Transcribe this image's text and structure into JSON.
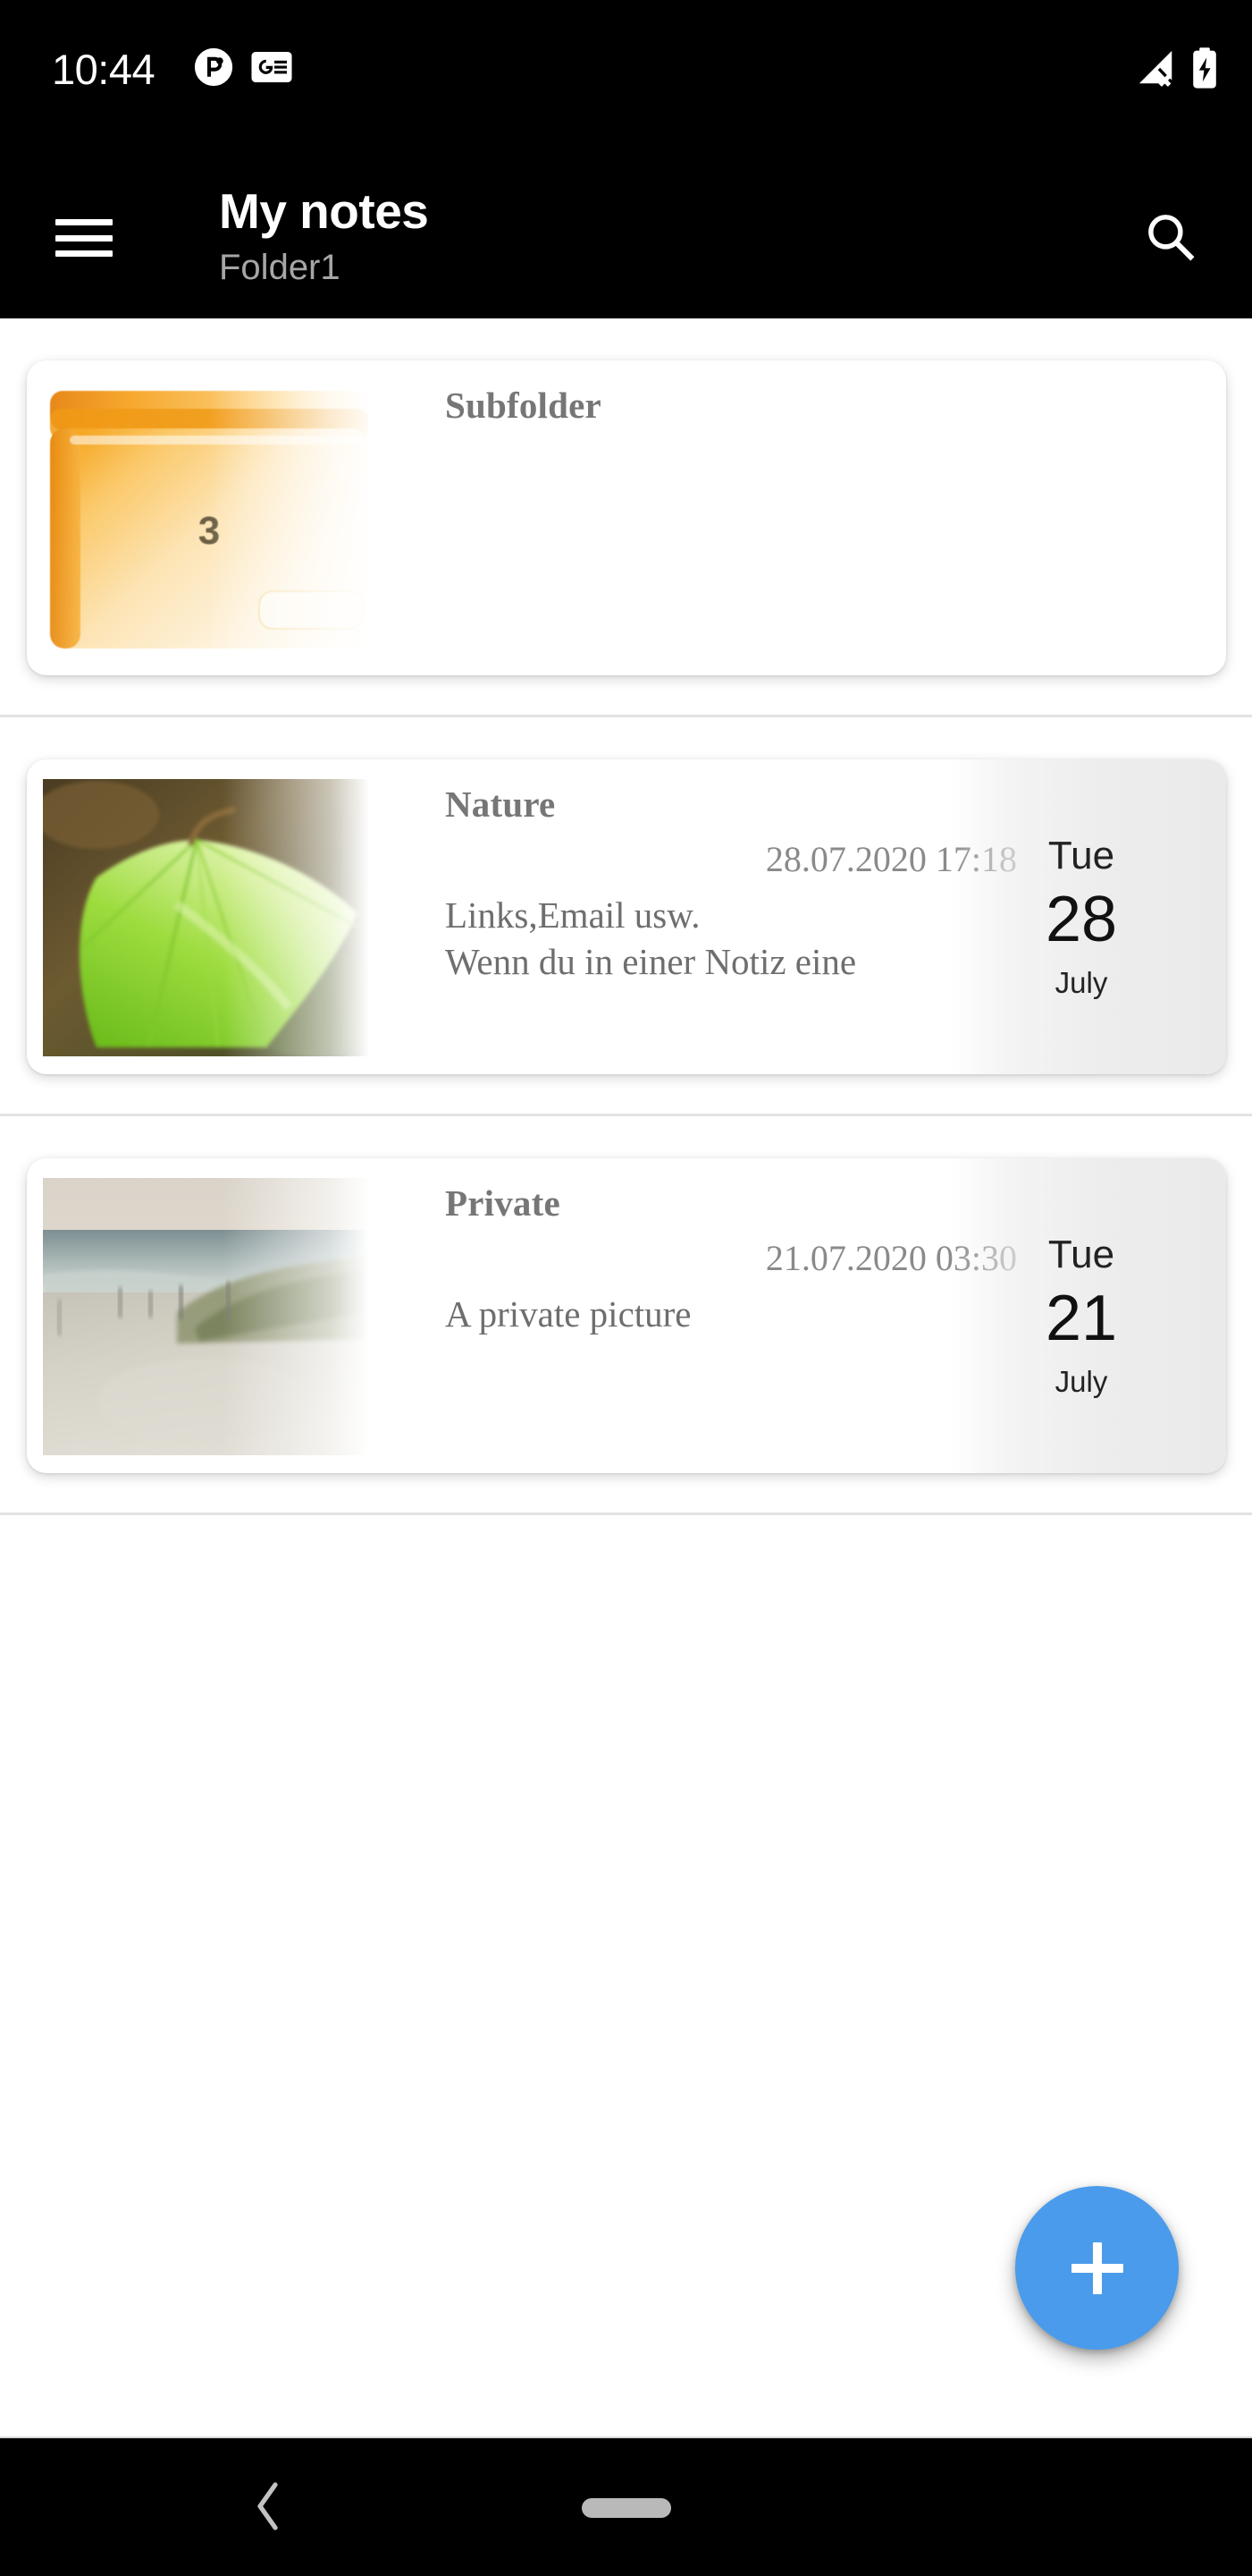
{
  "status_bar": {
    "time": "10:44",
    "notification_icons": [
      "app-notification-icon",
      "news-card-icon"
    ],
    "right_icons": [
      "signal-off-icon",
      "battery-charging-icon"
    ]
  },
  "app_bar": {
    "menu_icon": "hamburger-menu-icon",
    "title": "My notes",
    "subtitle": "Folder1",
    "search_icon": "search-icon"
  },
  "colors": {
    "app_bar_bg": "#000000",
    "page_bg": "#ffffff",
    "fab": "#4a9beb",
    "folder_orange": "#f5a425",
    "divider": "#e3e3e3",
    "title_text": "#767676"
  },
  "list": [
    {
      "type": "folder",
      "name": "folder-item",
      "title": "Subfolder",
      "count": "3",
      "thumb": "folder-icon"
    },
    {
      "type": "note",
      "name": "note-item",
      "title": "Nature",
      "datetime": "28.07.2020 17:18",
      "snippet_line1": "Links,Email usw.",
      "snippet_line2": "Wenn du in einer Notiz eine",
      "thumb": "leaf-photo-thumbnail",
      "date": {
        "weekday": "Tue",
        "day": "28",
        "month": "July"
      }
    },
    {
      "type": "note",
      "name": "note-item",
      "title": "Private",
      "datetime": "21.07.2020 03:30",
      "snippet_line1": "A private picture",
      "snippet_line2": "",
      "thumb": "beach-photo-thumbnail",
      "date": {
        "weekday": "Tue",
        "day": "21",
        "month": "July"
      }
    }
  ],
  "fab": {
    "icon": "plus-icon",
    "label": "+"
  },
  "nav_bar": {
    "back_icon": "back-chevron-icon",
    "home_icon": "home-pill-icon"
  }
}
